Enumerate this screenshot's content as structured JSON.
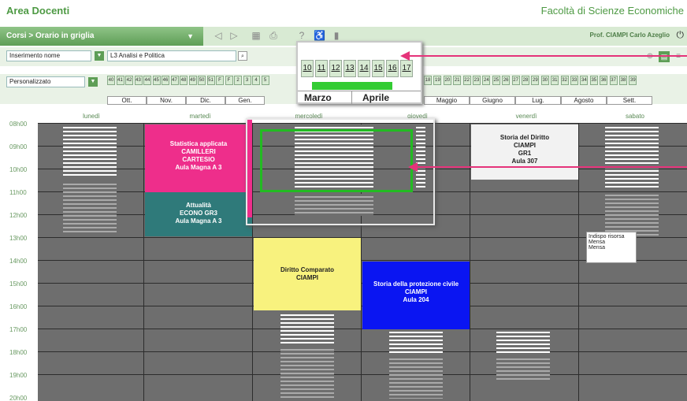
{
  "header": {
    "title": "Area Docenti",
    "faculty": "Facoltà di Scienze Economiche"
  },
  "toolbar": {
    "breadcrumb": "Corsi > Orario in griglia",
    "professor": "Prof. CIAMPI Carlo Azeglio"
  },
  "filters": {
    "insert_label": "Inserimento nome",
    "course_value": "L3 Analisi e Politica",
    "period_label": "Personalizzato"
  },
  "weeks_left": [
    "40",
    "41",
    "42",
    "43",
    "44",
    "45",
    "46",
    "47",
    "48",
    "49",
    "50",
    "51",
    "F",
    "F",
    "2",
    "3",
    "4",
    "5"
  ],
  "weeks_right": [
    "18",
    "19",
    "20",
    "21",
    "22",
    "23",
    "24",
    "25",
    "26",
    "27",
    "28",
    "29",
    "30",
    "31",
    "32",
    "33",
    "34",
    "35",
    "36",
    "37",
    "38",
    "39"
  ],
  "months_left": [
    "Ott.",
    "Nov.",
    "Dic.",
    "Gen."
  ],
  "months_right": [
    "Maggio",
    "Giugno",
    "Lug.",
    "Agosto",
    "Sett."
  ],
  "zoom": {
    "weeks": [
      "10",
      "11",
      "12",
      "13",
      "14",
      "15",
      "16",
      "17"
    ],
    "months": [
      "Marzo",
      "Aprile"
    ]
  },
  "days": [
    "lunedì",
    "martedì",
    "mercoledì",
    "giovedì",
    "venerdì",
    "sabato"
  ],
  "hours": [
    "08h00",
    "09h00",
    "10h00",
    "11h00",
    "12h00",
    "13h00",
    "14h00",
    "15h00",
    "16h00",
    "17h00",
    "18h00",
    "19h00",
    "20h00"
  ],
  "events": {
    "stat": {
      "l1": "Statistica applicata",
      "l2": "CAMILLERI",
      "l3": "CARTESIO",
      "l4": "Aula Magna A 3"
    },
    "att": {
      "l1": "Attualità",
      "l2": "ECONO GR3",
      "l3": "Aula Magna A 3"
    },
    "dir": {
      "l1": "Diritto Comparato",
      "l2": "CIAMPI"
    },
    "storia_prot": {
      "l1": "Storia della protezione civile",
      "l2": "CIAMPI",
      "l3": "Aula 204"
    },
    "storia_dir": {
      "l1": "Storia del Diritto",
      "l2": "CIAMPI",
      "l3": "GR1",
      "l4": "Aula 307"
    }
  },
  "tooltip": {
    "l1": "Indispo risorsa",
    "l2": "Mensa",
    "l3": "Mensa"
  },
  "colors": {
    "stat": "#ee2e8b",
    "att": "#2f7a7a",
    "dir": "#f8f27e",
    "storia_prot": "#0a15f2",
    "storia_dir": "#f2f2f2",
    "accent": "#e5337a"
  }
}
